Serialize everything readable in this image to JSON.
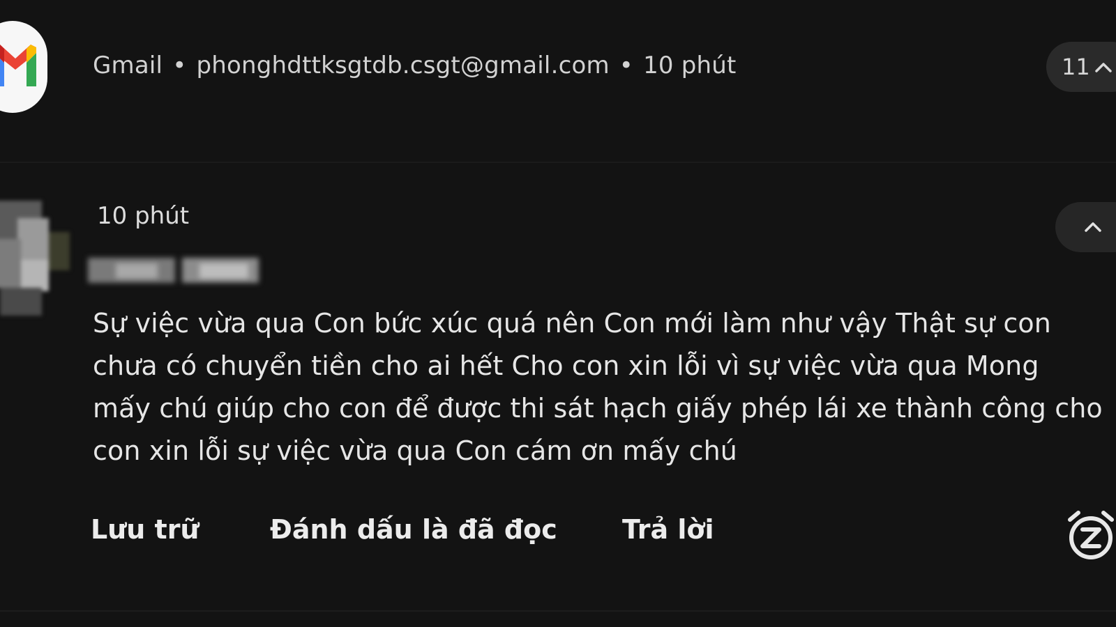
{
  "header": {
    "app_name": "Gmail",
    "separator": "•",
    "sender_email": "phonghdttksgtdb.csgt@gmail.com",
    "time": "10 phút",
    "count": "11"
  },
  "message": {
    "time": "10 phút",
    "body": "Sự việc vừa qua Con bức xúc quá nên Con mới làm như vậy Thật sự con chưa có chuyển tiền cho ai hết Cho con xin lỗi vì sự việc vừa qua Mong mấy chú giúp cho con để được thi sát hạch giấy phép lái xe thành công cho con xin lỗi sự việc vừa qua Con cám ơn mấy chú"
  },
  "actions": {
    "archive": "Lưu trữ",
    "mark_read": "Đánh dấu là đã đọc",
    "reply": "Trả lời"
  },
  "icons": {
    "app": "gmail-logo-icon",
    "expand": "chevron-up-icon",
    "snooze": "snooze-alarm-icon"
  },
  "colors": {
    "background": "#131313",
    "chip": "#2a2a2a",
    "text": "#e3e3e3"
  }
}
